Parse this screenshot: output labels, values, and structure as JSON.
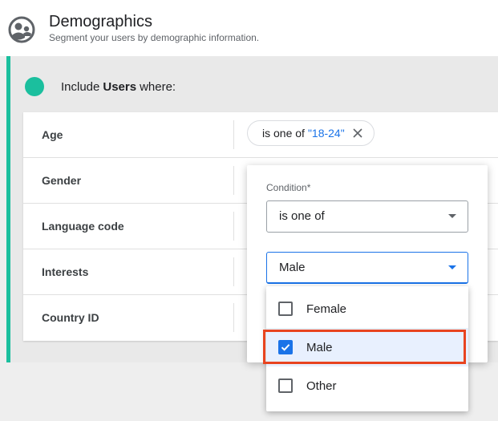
{
  "header": {
    "title": "Demographics",
    "subtitle": "Segment your users by demographic information."
  },
  "include": {
    "prefix": "Include",
    "entity": "Users",
    "suffix": "where:"
  },
  "rows": [
    {
      "label": "Age"
    },
    {
      "label": "Gender"
    },
    {
      "label": "Language code"
    },
    {
      "label": "Interests"
    },
    {
      "label": "Country ID"
    }
  ],
  "age_chip": {
    "condition": "is one of",
    "value": "\"18-24\""
  },
  "popup": {
    "condition_label": "Condition*",
    "condition_value": "is one of",
    "value_select": "Male"
  },
  "options": [
    {
      "label": "Female",
      "checked": false
    },
    {
      "label": "Male",
      "checked": true
    },
    {
      "label": "Other",
      "checked": false
    }
  ],
  "colors": {
    "accent": "#1bbf9e",
    "link_blue": "#1a73e8",
    "highlight": "#e8441f"
  }
}
